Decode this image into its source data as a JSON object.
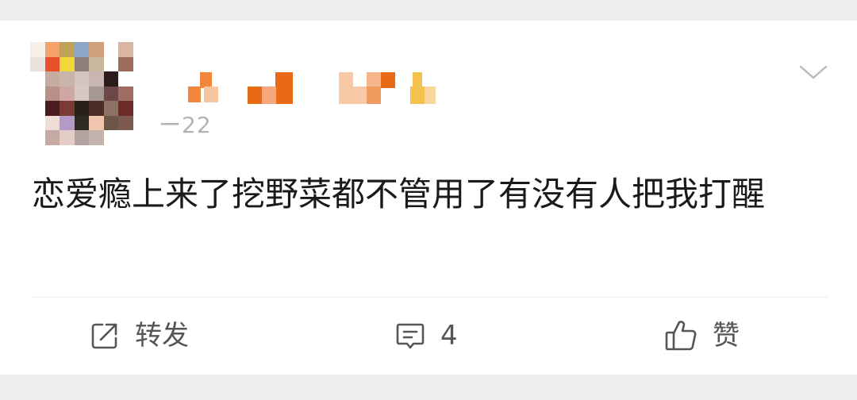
{
  "post": {
    "username": "",
    "timestamp": "ー22",
    "text": "恋爱瘾上来了挖野菜都不管用了有没有人把我打醒",
    "menu_icon": "chevron-down-icon"
  },
  "actions": {
    "repost": {
      "label": "转发",
      "icon": "share-icon"
    },
    "comment": {
      "label": "4",
      "icon": "comment-icon"
    },
    "like": {
      "label": "赞",
      "icon": "thumbs-up-icon"
    }
  },
  "colors": {
    "text": "#1a1a1a",
    "muted": "#b3b3b3",
    "action": "#555555",
    "background": "#ffffff"
  }
}
